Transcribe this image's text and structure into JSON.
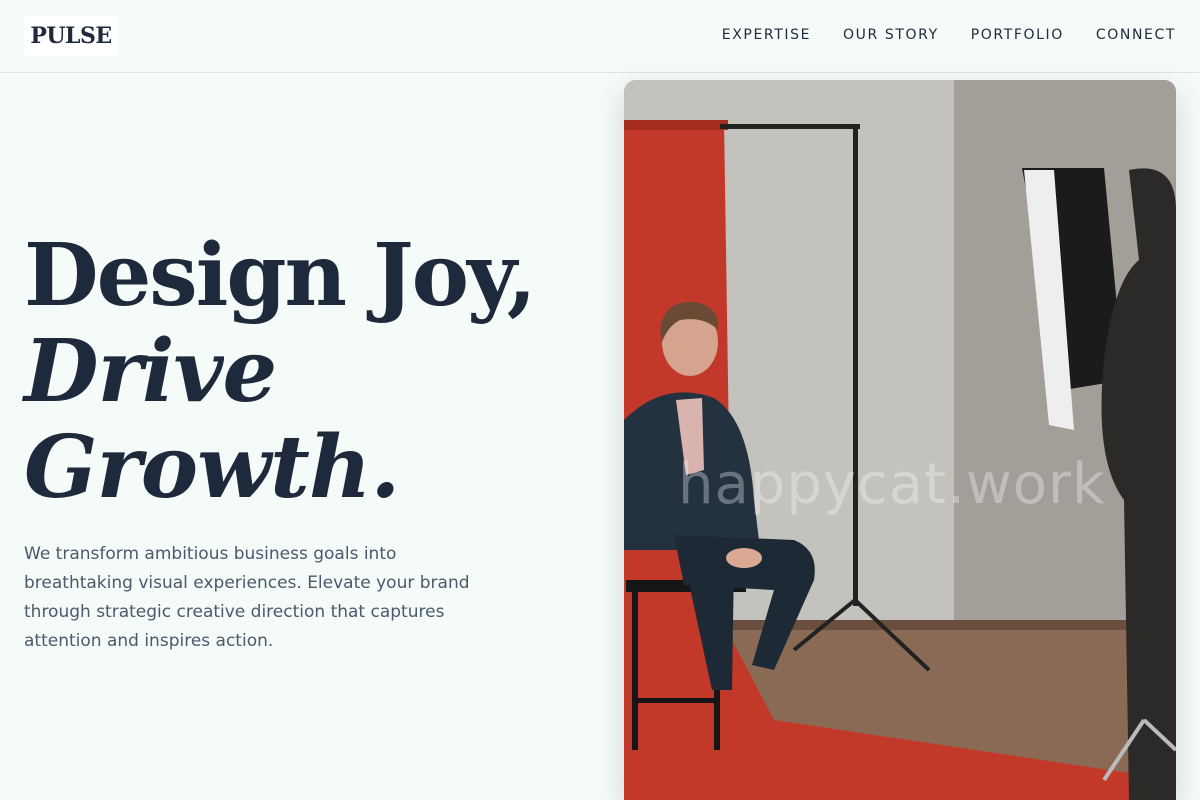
{
  "header": {
    "logo": "PULSE",
    "nav": [
      "EXPERTISE",
      "OUR STORY",
      "PORTFOLIO",
      "CONNECT"
    ]
  },
  "hero": {
    "headline_line1": "Design Joy,",
    "headline_line2": "Drive",
    "headline_line3": "Growth.",
    "intro": "We transform ambitious business goals into breathtaking visual experiences. Elevate your brand through strategic creative direction that captures attention and inspires action.",
    "image_watermark": "happycat.work"
  },
  "colors": {
    "background": "#f4fbf8",
    "text_primary": "#1e293b",
    "text_secondary": "#4a5a6c",
    "backdrop_red": "#c2392a"
  }
}
